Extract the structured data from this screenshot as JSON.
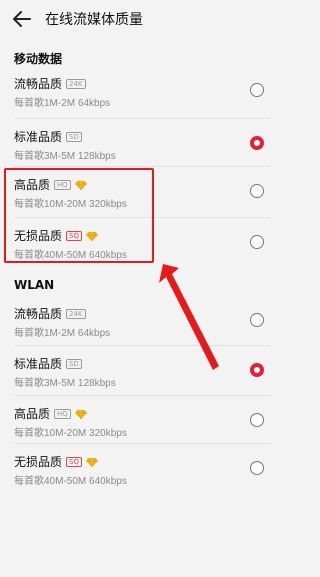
{
  "header": {
    "title": "在线流媒体质量"
  },
  "sections": [
    {
      "label": "移动数据",
      "items": [
        {
          "name": "流畅品质",
          "badge": "24K",
          "badge_type": "grey",
          "diamond": false,
          "desc": "每首歌1M-2M 64kbps",
          "selected": false
        },
        {
          "name": "标准品质",
          "badge": "SD",
          "badge_type": "grey",
          "diamond": false,
          "desc": "每首歌3M-5M 128kbps",
          "selected": true
        },
        {
          "name": "高品质",
          "badge": "HQ",
          "badge_type": "grey",
          "diamond": true,
          "desc": "每首歌10M-20M 320kbps",
          "selected": false
        },
        {
          "name": "无损品质",
          "badge": "SQ",
          "badge_type": "sq",
          "diamond": true,
          "desc": "每首歌40M-50M 640kbps",
          "selected": false
        }
      ]
    },
    {
      "label": "WLAN",
      "items": [
        {
          "name": "流畅品质",
          "badge": "24K",
          "badge_type": "grey",
          "diamond": false,
          "desc": "每首歌1M-2M 64kbps",
          "selected": false
        },
        {
          "name": "标准品质",
          "badge": "SD",
          "badge_type": "grey",
          "diamond": false,
          "desc": "每首歌3M-5M 128kbps",
          "selected": true
        },
        {
          "name": "高品质",
          "badge": "HQ",
          "badge_type": "grey",
          "diamond": true,
          "desc": "每首歌10M-20M 320kbps",
          "selected": false
        },
        {
          "name": "无损品质",
          "badge": "SQ",
          "badge_type": "sq",
          "diamond": true,
          "desc": "每首歌40M-50M 640kbps",
          "selected": false
        }
      ]
    }
  ],
  "icons": {
    "back": "arrow-left-icon",
    "vip": "diamond-icon"
  },
  "colors": {
    "accent": "#e3203b",
    "annotation": "#e51b1b"
  }
}
